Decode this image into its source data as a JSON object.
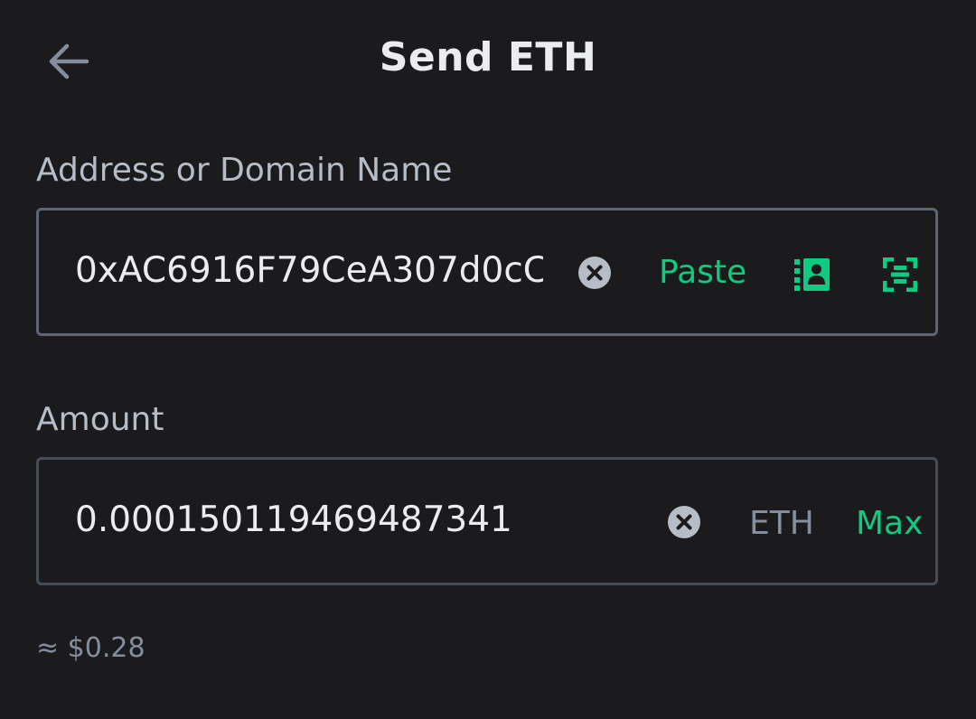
{
  "header": {
    "title": "Send ETH",
    "back_icon": "arrow-left-icon"
  },
  "address_field": {
    "label": "Address or Domain Name",
    "value": "0xAC6916F79CeA307d0cC",
    "clear_icon": "clear-circle-icon",
    "paste_label": "Paste",
    "address_book_icon": "address-book-icon",
    "scan_icon": "qr-scan-icon"
  },
  "amount_field": {
    "label": "Amount",
    "value": "0.00015011946948734​1",
    "clear_icon": "clear-circle-icon",
    "unit": "ETH",
    "max_label": "Max"
  },
  "fiat_estimate": "≈ $0.28",
  "colors": {
    "background": "#1b1b1d",
    "accent": "#0ecb81",
    "text_primary": "#eaecef",
    "text_secondary": "#b7bdc6",
    "text_muted": "#848e9c",
    "border": "#474d57"
  }
}
